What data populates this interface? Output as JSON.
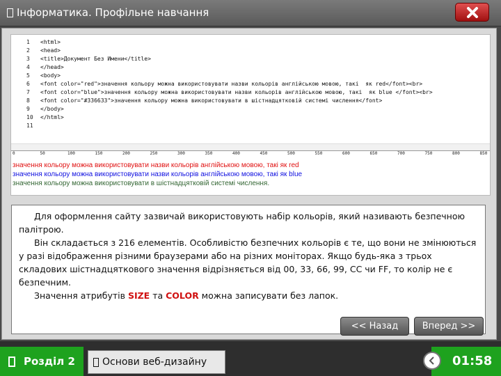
{
  "window": {
    "title": "Інформатика. Профільне навчання"
  },
  "editor": {
    "line_numbers": [
      "1",
      "2",
      "3",
      "4",
      "5",
      "6",
      "7",
      "8",
      "9",
      "10",
      "11"
    ],
    "code_lines": [
      "<html>",
      "<head>",
      "<title>Документ Без Имени</title>",
      "</head>",
      "<body>",
      "<font color=\"red\">значення кольору можна використовувати назви кольорів англійською мовою, такі  як red</font><br>",
      "<font color=\"blue\">значення кольору можна використовувати назви кольорів англійською мовою, такі  як blue </font><br>",
      "<font color=\"#336633\">значення кольору можна використовувати в шістнадцятковій системі числення</font>",
      "</body>",
      "</html>",
      ""
    ],
    "ruler_ticks": [
      "0",
      "50",
      "100",
      "150",
      "200",
      "250",
      "300",
      "350",
      "400",
      "450",
      "500",
      "550",
      "600",
      "650",
      "700",
      "750",
      "800",
      "850"
    ],
    "preview": [
      {
        "text": "значення кольору можна використовувати назви кольорів англійською мовою, такі як red",
        "color": "#e01010"
      },
      {
        "text": "значення кольору можна використовувати назви кольорів англійською мовою, такі як blue",
        "color": "#1010e0"
      },
      {
        "text": "значення кольору можна використовувати в шістнадцятковій системі числення.",
        "color": "#336633"
      }
    ]
  },
  "text": {
    "p1": "Для оформлення сайту зазвичай використовують набір кольорів,  який називають безпечною палітрою.",
    "p2": "Він складається з 216 елементів. Особливістю безпечних кольорів є те, що вони не змінюються у разі відображення різними браузерами або на різних моніторах. Якщо будь-яка з трьох складових шістнадцяткового значення відрізняється від 00, 33, 66, 99, CC чи FF, то колір не є безпечним.",
    "p3_before": "Значення атрибутів ",
    "p3_size": "SIZE",
    "p3_mid": " та ",
    "p3_color": "COLOR",
    "p3_after": " можна записувати без лапок."
  },
  "nav": {
    "back_label": "<< Назад",
    "forward_label": "Вперед >>"
  },
  "footer": {
    "section_label": "Розділ 2",
    "topic_label": "Основи веб-дизайну",
    "timer": "01:58"
  },
  "colors": {
    "accent_green": "#1ea21e",
    "close_red": "#c02020",
    "highlight_red": "#d01010"
  }
}
